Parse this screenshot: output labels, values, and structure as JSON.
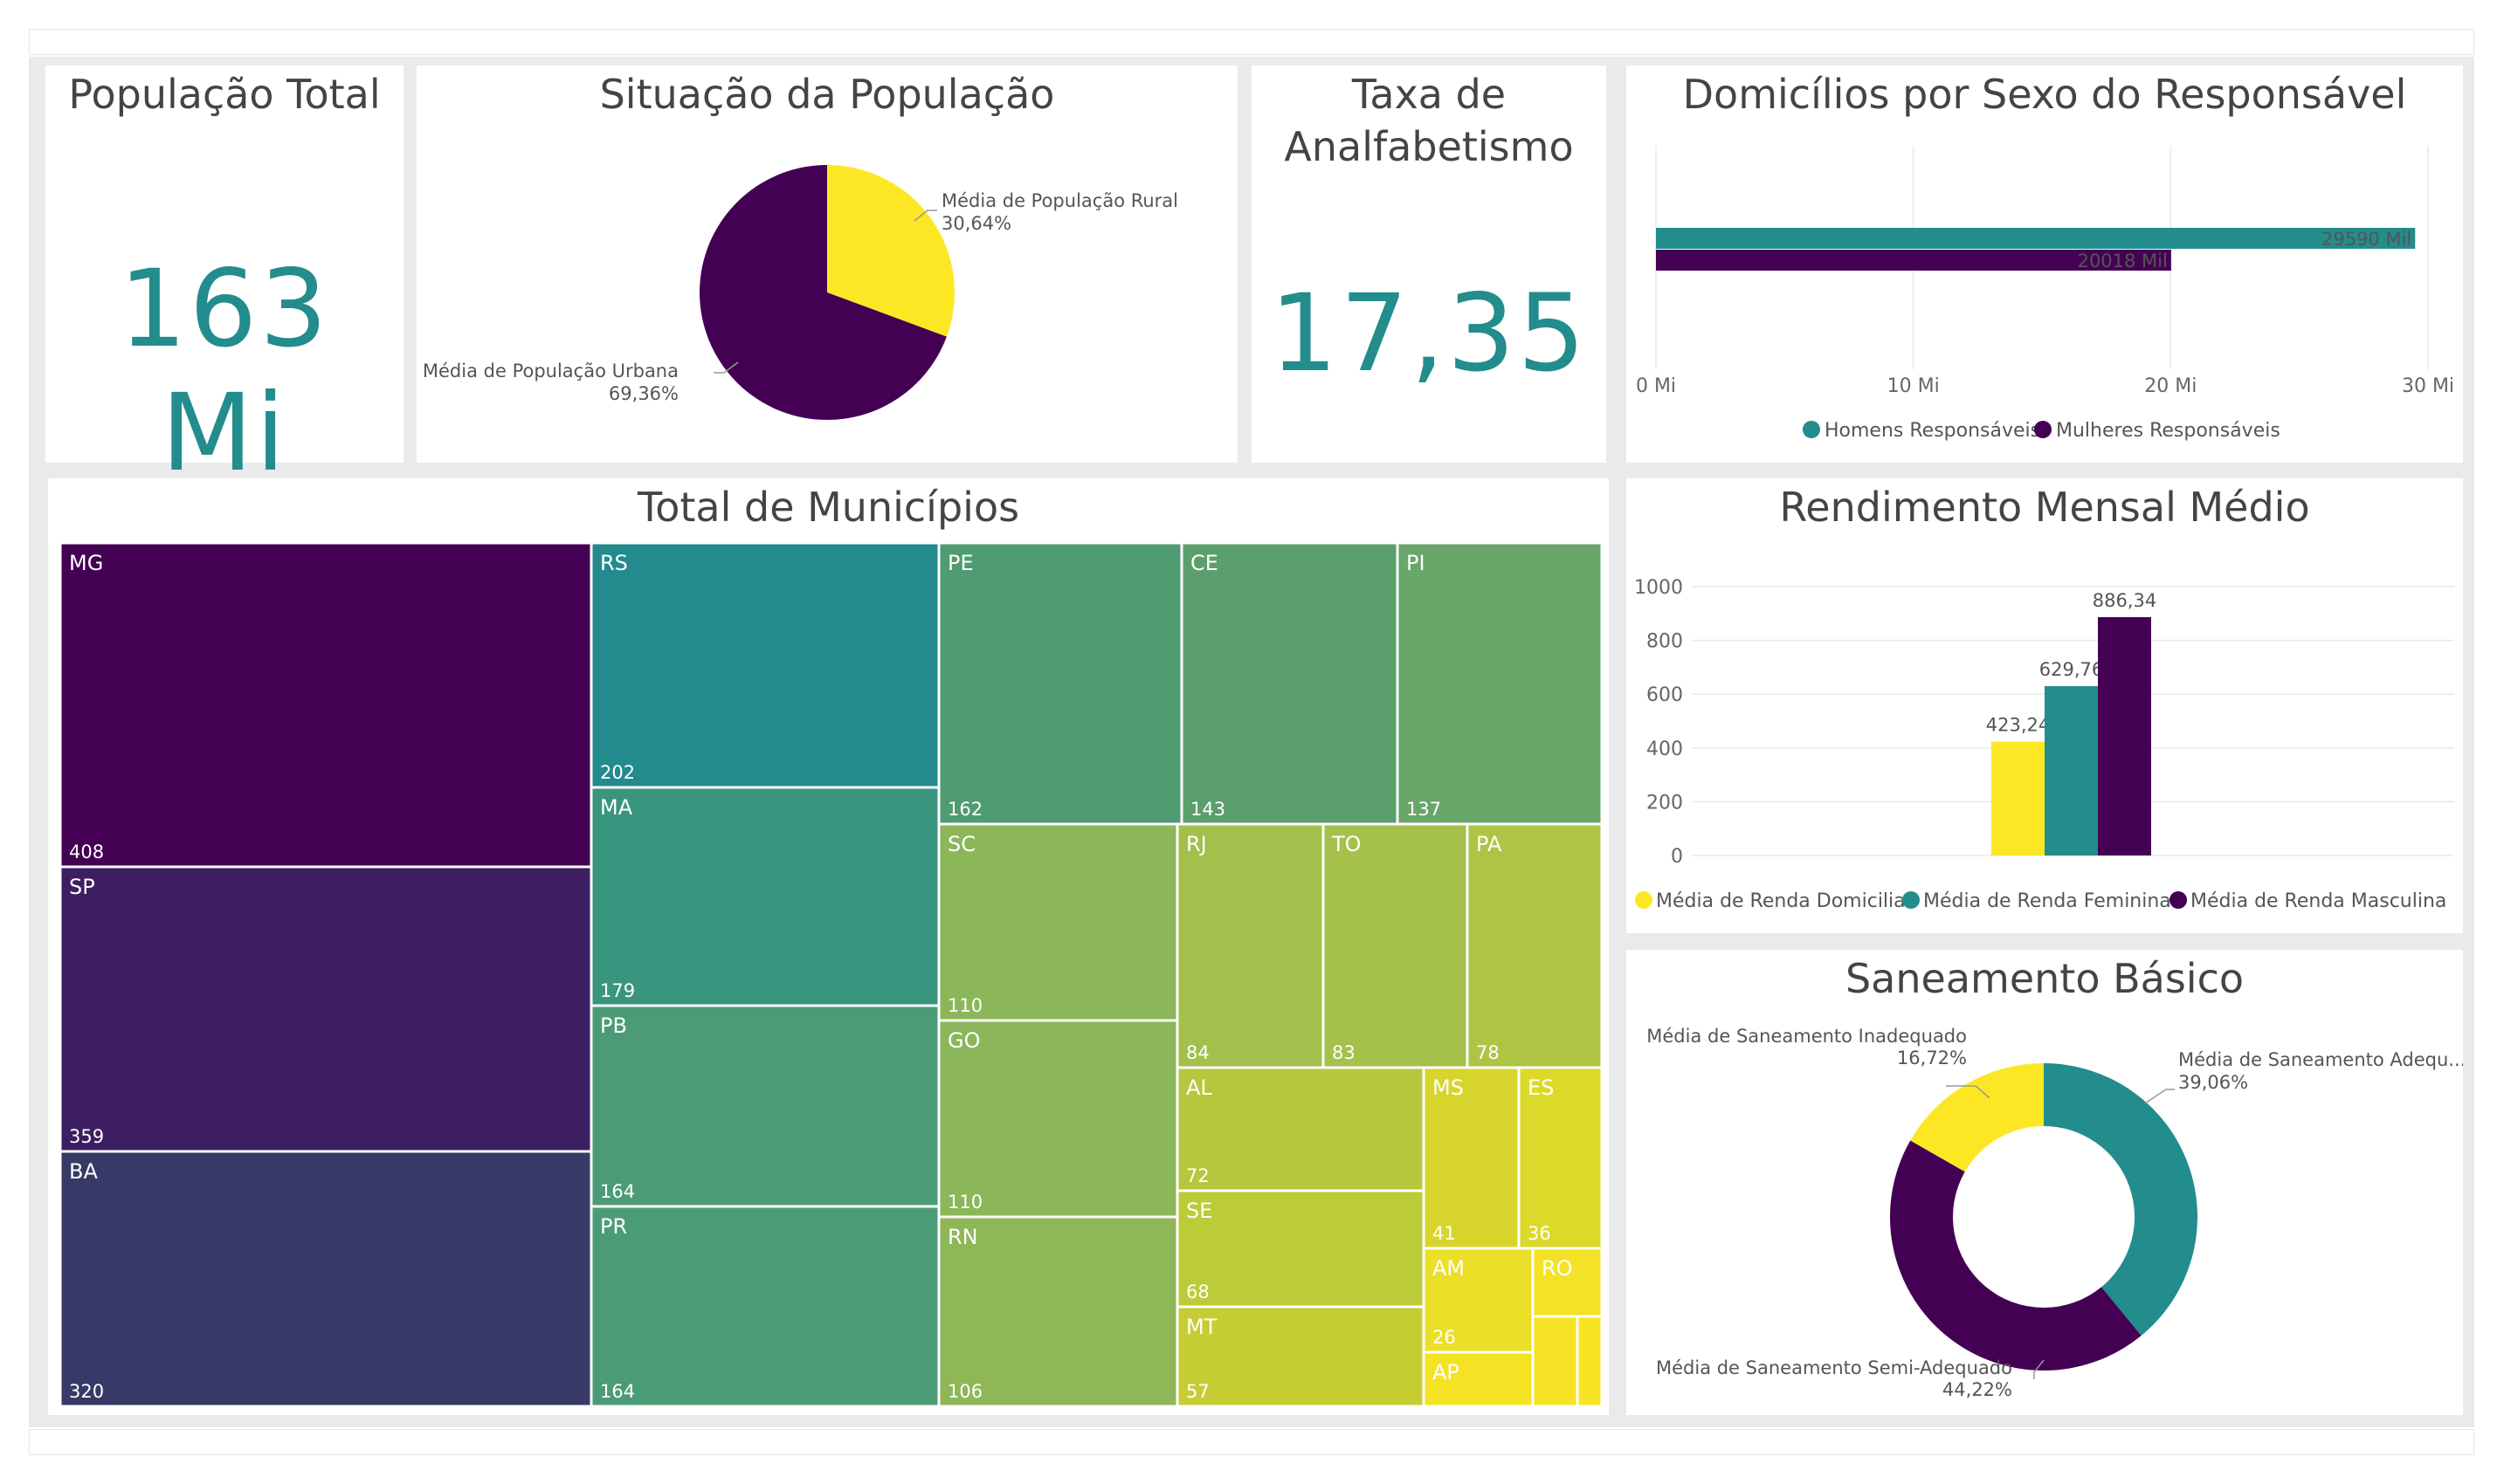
{
  "colors": {
    "teal": "#238c8c",
    "purple": "#440154",
    "yellow": "#fde725"
  },
  "kpi_population": {
    "title": "População Total",
    "value": "163 Mi"
  },
  "kpi_illiteracy": {
    "title_line1": "Taxa de",
    "title_line2": "Analfabetismo",
    "value": "17,35"
  },
  "chart_data": [
    {
      "id": "situacao",
      "type": "pie",
      "title": "Situação da População",
      "slices": [
        {
          "label": "Média de População Rural",
          "value": 30.64,
          "value_label": "30,64%",
          "color": "#fde725"
        },
        {
          "label": "Média de População Urbana",
          "value": 69.36,
          "value_label": "69,36%",
          "color": "#440154"
        }
      ]
    },
    {
      "id": "domicilios",
      "type": "bar",
      "orientation": "horizontal",
      "title": "Domicílios por Sexo do Responsável",
      "xlim": [
        0,
        30
      ],
      "x_ticks": [
        "0 Mi",
        "10 Mi",
        "20 Mi",
        "30 Mi"
      ],
      "series": [
        {
          "name": "Homens Responsáveis",
          "value": 29.5,
          "value_label": "29590 Mil",
          "color": "#238c8c"
        },
        {
          "name": "Mulheres Responsáveis",
          "value": 20.018,
          "value_label": "20018 Mil",
          "color": "#440154"
        }
      ],
      "legend": "bottom"
    },
    {
      "id": "municipios",
      "type": "treemap",
      "title": "Total de Municípios",
      "items": [
        {
          "label": "MG",
          "value": 408,
          "color": "#440154"
        },
        {
          "label": "SP",
          "value": 359,
          "color": "#3d1e62"
        },
        {
          "label": "BA",
          "value": 320,
          "color": "#373a66"
        },
        {
          "label": "RS",
          "value": 202,
          "color": "#238a8d"
        },
        {
          "label": "MA",
          "value": 179,
          "color": "#3a957f"
        },
        {
          "label": "PB",
          "value": 164,
          "color": "#4c9b77"
        },
        {
          "label": "PR",
          "value": 164,
          "color": "#4c9b77"
        },
        {
          "label": "PE",
          "value": 162,
          "color": "#4f9b72"
        },
        {
          "label": "CE",
          "value": 143,
          "color": "#5b9f6c"
        },
        {
          "label": "PI",
          "value": 137,
          "color": "#69a66a"
        },
        {
          "label": "SC",
          "value": 110,
          "color": "#8bb65a"
        },
        {
          "label": "GO",
          "value": 110,
          "color": "#8bb65a"
        },
        {
          "label": "RN",
          "value": 106,
          "color": "#8fb657"
        },
        {
          "label": "RJ",
          "value": 84,
          "color": "#a3bf4c"
        },
        {
          "label": "TO",
          "value": 83,
          "color": "#a5c04b"
        },
        {
          "label": "PA",
          "value": 78,
          "color": "#adc444"
        },
        {
          "label": "AL",
          "value": 72,
          "color": "#b5c73c"
        },
        {
          "label": "SE",
          "value": 68,
          "color": "#bccb38"
        },
        {
          "label": "MT",
          "value": 57,
          "color": "#c5cd33"
        },
        {
          "label": "MS",
          "value": 41,
          "color": "#d7d52c"
        },
        {
          "label": "ES",
          "value": 36,
          "color": "#dcd92a"
        },
        {
          "label": "AM",
          "value": 26,
          "color": "#ebdf28"
        },
        {
          "label": "AP",
          "value": null,
          "color": "#f4e225"
        },
        {
          "label": "RO",
          "value": null,
          "color": "#f3e226"
        },
        {
          "label": "",
          "value": null,
          "color": "#f6e326"
        },
        {
          "label": "",
          "value": null,
          "color": "#f8e425"
        }
      ]
    },
    {
      "id": "rendimento",
      "type": "bar",
      "title": "Rendimento Mensal Médio",
      "ylim": [
        0,
        1000
      ],
      "y_ticks": [
        0,
        200,
        400,
        600,
        800,
        1000
      ],
      "series": [
        {
          "name": "Média de Renda Domiciliar",
          "value": 423.24,
          "value_label": "423,24",
          "color": "#fde725"
        },
        {
          "name": "Média de Renda Feminina",
          "value": 629.76,
          "value_label": "629,76",
          "color": "#238c8c"
        },
        {
          "name": "Média de Renda Masculina",
          "value": 886.34,
          "value_label": "886,34",
          "color": "#440154"
        }
      ],
      "legend": "bottom"
    },
    {
      "id": "saneamento",
      "type": "pie",
      "donut": true,
      "title": "Saneamento Básico",
      "slices": [
        {
          "label": "Média de Saneamento Adequ...",
          "value": 39.06,
          "value_label": "39,06%",
          "color": "#238c8c"
        },
        {
          "label": "Média de Saneamento Semi-Adequado",
          "value": 44.22,
          "value_label": "44,22%",
          "color": "#440154"
        },
        {
          "label": "Média de Saneamento Inadequado",
          "value": 16.72,
          "value_label": "16,72%",
          "color": "#fde725"
        }
      ]
    }
  ]
}
